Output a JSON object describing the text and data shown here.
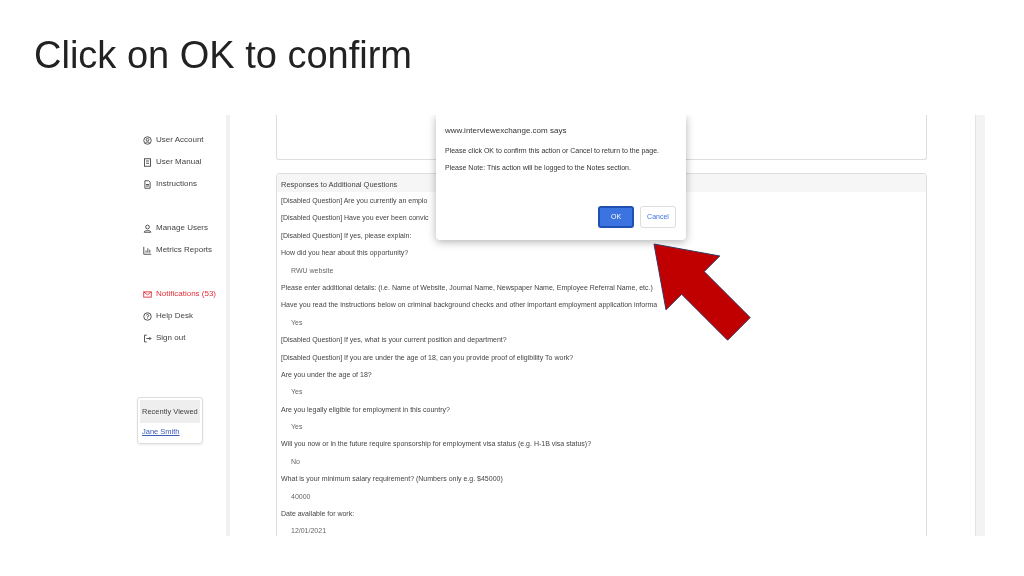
{
  "slide_title": "Click on OK to confirm",
  "sidebar": {
    "groups": [
      [
        {
          "label": "User Account",
          "highlighted": false
        },
        {
          "label": "User Manual",
          "highlighted": false
        },
        {
          "label": "Instructions",
          "highlighted": false
        }
      ],
      [
        {
          "label": "Manage Users",
          "highlighted": false
        },
        {
          "label": "Metrics Reports",
          "highlighted": false
        }
      ],
      [
        {
          "label": "Notifications (53)",
          "highlighted": true
        },
        {
          "label": "Help Desk",
          "highlighted": false
        },
        {
          "label": "Sign out",
          "highlighted": false
        }
      ]
    ],
    "recently_viewed": {
      "title": "Recently Viewed",
      "links": [
        "Jane Smith"
      ]
    }
  },
  "responses": {
    "title": "Responses to Additional Questions",
    "rows": [
      {
        "kind": "question",
        "text": "[Disabled Question] Are you currently an emplo"
      },
      {
        "kind": "question",
        "text": "[Disabled Question] Have you ever been convic"
      },
      {
        "kind": "question",
        "text": "[Disabled Question] If yes, please explain:"
      },
      {
        "kind": "question",
        "text": "How did you hear about this opportunity?"
      },
      {
        "kind": "answer",
        "text": "RWU website"
      },
      {
        "kind": "question",
        "text": "Please enter additional details: (i.e. Name of Website, Journal Name, Newspaper Name, Employee Referral Name, etc.)"
      },
      {
        "kind": "question",
        "text": "Have you read the instructions below on criminal background checks and other important employment application informa"
      },
      {
        "kind": "answer",
        "text": "Yes"
      },
      {
        "kind": "question",
        "text": "[Disabled Question] If yes, what is your current position and department?"
      },
      {
        "kind": "question",
        "text": "[Disabled Question] If you are under the age of 18, can you provide proof of eligibility To work?"
      },
      {
        "kind": "question",
        "text": "Are you under the age of 18?"
      },
      {
        "kind": "answer",
        "text": "Yes"
      },
      {
        "kind": "question",
        "text": "Are you legally eligible for employment in this country?"
      },
      {
        "kind": "answer",
        "text": "Yes"
      },
      {
        "kind": "question",
        "text": "Will you now or in the future require sponsorship for employment visa status (e.g. H-1B visa status)?"
      },
      {
        "kind": "answer",
        "text": "No"
      },
      {
        "kind": "question",
        "text": "What is your minimum salary requirement? (Numbers only e.g. $45000)"
      },
      {
        "kind": "answer",
        "text": "40000"
      },
      {
        "kind": "question",
        "text": "Date available for work:"
      },
      {
        "kind": "answer",
        "text": "12/01/2021"
      }
    ]
  },
  "dialog": {
    "origin": "www.interviewexchange.com says",
    "message": [
      "Please click OK to confirm this action or Cancel to return to the page.",
      "Please Note: This action will be logged to the Notes section."
    ],
    "buttons": [
      {
        "label": "OK",
        "primary": true
      },
      {
        "label": "Cancel",
        "primary": false
      }
    ]
  }
}
